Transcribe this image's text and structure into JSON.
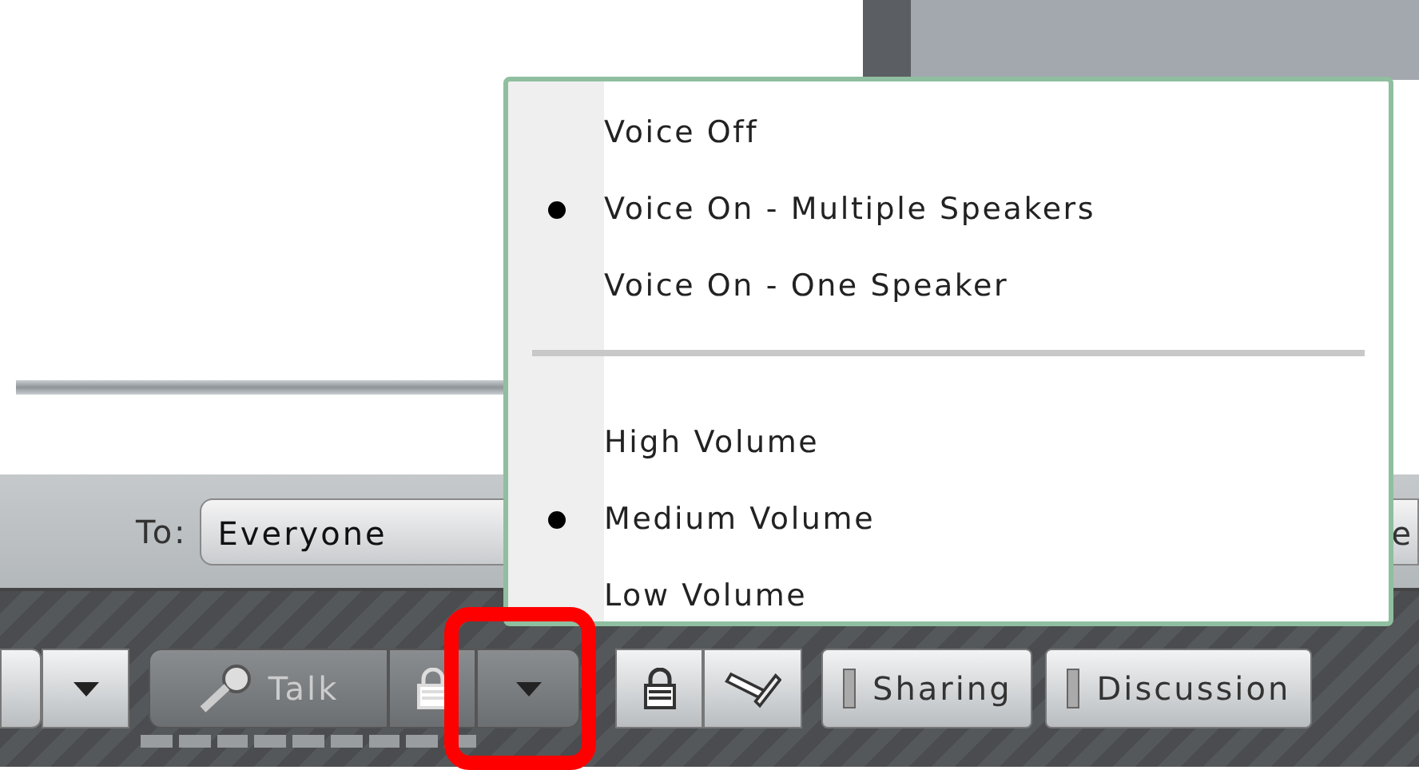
{
  "chat_bar": {
    "to_label": "To:",
    "recipient": "Everyone",
    "right_button": "e"
  },
  "toolbar": [
    {
      "kind": "caret"
    },
    {
      "kind": "talk",
      "label": "Talk"
    },
    {
      "kind": "lock"
    },
    {
      "kind": "caret",
      "highlighted": true
    },
    {
      "kind": "lock"
    },
    {
      "kind": "pencil"
    },
    {
      "kind": "tab",
      "label": "Sharing"
    },
    {
      "kind": "tab",
      "label": "Discussion"
    }
  ],
  "menu": {
    "groups": [
      {
        "items": [
          {
            "label": "Voice Off",
            "selected": false
          },
          {
            "label": "Voice On - Multiple Speakers",
            "selected": true
          },
          {
            "label": "Voice On - One Speaker",
            "selected": false
          }
        ]
      },
      {
        "items": [
          {
            "label": "High Volume",
            "selected": false
          },
          {
            "label": "Medium Volume",
            "selected": true
          },
          {
            "label": "Low Volume",
            "selected": false
          }
        ]
      }
    ]
  }
}
